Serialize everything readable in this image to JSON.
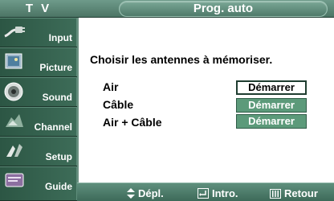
{
  "header": {
    "source": "T V",
    "title": "Prog. auto"
  },
  "sidebar": {
    "items": [
      {
        "label": "Input",
        "icon": "input-plug-icon"
      },
      {
        "label": "Picture",
        "icon": "picture-icon"
      },
      {
        "label": "Sound",
        "icon": "sound-speaker-icon"
      },
      {
        "label": "Channel",
        "icon": "channel-satellite-icon"
      },
      {
        "label": "Setup",
        "icon": "setup-icon"
      },
      {
        "label": "Guide",
        "icon": "guide-icon"
      }
    ]
  },
  "main": {
    "heading": "Choisir les antennes à mémoriser.",
    "options": [
      {
        "label": "Air",
        "button": "Démarrer",
        "selected": true
      },
      {
        "label": "Câble",
        "button": "Démarrer",
        "selected": false
      },
      {
        "label": "Air + Câble",
        "button": "Démarrer",
        "selected": false
      }
    ]
  },
  "footer": {
    "move": "Dépl.",
    "enter": "Intro.",
    "return": "Retour"
  }
}
